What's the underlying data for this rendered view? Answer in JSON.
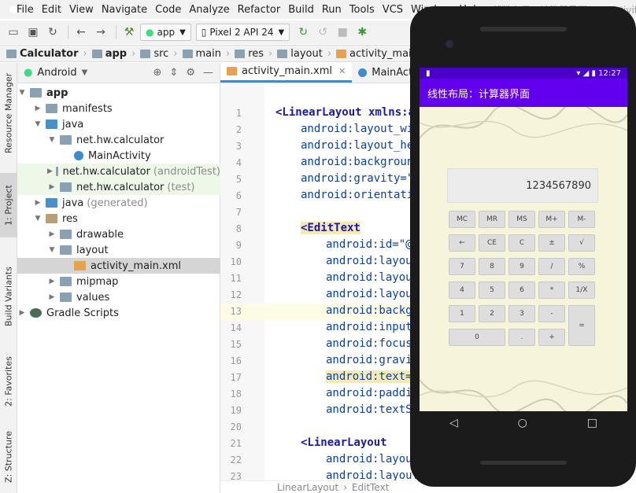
{
  "menubar": {
    "items": [
      "File",
      "Edit",
      "View",
      "Navigate",
      "Code",
      "Analyze",
      "Refactor",
      "Build",
      "Run",
      "Tools",
      "VCS",
      "Window",
      "Help"
    ],
    "title": "线性布局：计算器界面 - ...\\activity"
  },
  "toolbar": {
    "config": "app",
    "device": "Pixel 2 API 24"
  },
  "breadcrumbs": [
    "Calculator",
    "app",
    "src",
    "main",
    "res",
    "layout",
    "activity_main.xml"
  ],
  "leftstrip": {
    "tabs": [
      "Resource Manager",
      "1: Project",
      "Build Variants",
      "2: Favorites",
      "Z: Structure"
    ]
  },
  "project": {
    "view": "Android",
    "tree": [
      {
        "label": "app",
        "muted": ""
      },
      {
        "label": "manifests",
        "muted": ""
      },
      {
        "label": "java",
        "muted": ""
      },
      {
        "label": "net.hw.calculator",
        "muted": ""
      },
      {
        "label": "MainActivity",
        "muted": ""
      },
      {
        "label": "net.hw.calculator",
        "muted": "(androidTest)"
      },
      {
        "label": "net.hw.calculator",
        "muted": "(test)"
      },
      {
        "label": "java",
        "muted": "(generated)"
      },
      {
        "label": "res",
        "muted": ""
      },
      {
        "label": "drawable",
        "muted": ""
      },
      {
        "label": "layout",
        "muted": ""
      },
      {
        "label": "activity_main.xml",
        "muted": ""
      },
      {
        "label": "mipmap",
        "muted": ""
      },
      {
        "label": "values",
        "muted": ""
      },
      {
        "label": "Gradle Scripts",
        "muted": ""
      }
    ]
  },
  "editor": {
    "tabs": [
      "activity_main.xml",
      "MainActivity"
    ],
    "lines": [
      {
        "n": "1",
        "code": "<LinearLayout xmlns:an"
      },
      {
        "n": "2",
        "code": "android:layout_wid"
      },
      {
        "n": "3",
        "code": "android:layout_hei"
      },
      {
        "n": "4",
        "code": "android:background"
      },
      {
        "n": "5",
        "code": "android:gravity=\"c"
      },
      {
        "n": "6",
        "code": "android:orientatio"
      },
      {
        "n": "7",
        "code": ""
      },
      {
        "n": "8",
        "code": "<EditText"
      },
      {
        "n": "9",
        "code": "android:id=\"@+"
      },
      {
        "n": "10",
        "code": "android:layout"
      },
      {
        "n": "11",
        "code": "android:layout"
      },
      {
        "n": "12",
        "code": "android:layout"
      },
      {
        "n": "13",
        "code": "android:backgr"
      },
      {
        "n": "14",
        "code": "android:inputT"
      },
      {
        "n": "15",
        "code": "android:focusa"
      },
      {
        "n": "16",
        "code": "android:gravit"
      },
      {
        "n": "17",
        "code": "android:text=\""
      },
      {
        "n": "18",
        "code": "android:paddin"
      },
      {
        "n": "19",
        "code": "android:textSi"
      },
      {
        "n": "20",
        "code": ""
      },
      {
        "n": "21",
        "code": "<LinearLayout"
      },
      {
        "n": "22",
        "code": "android:layout"
      },
      {
        "n": "23",
        "code": "android:layout"
      }
    ],
    "status": [
      "LinearLayout",
      "EditText"
    ]
  },
  "phone": {
    "time": "12:27",
    "app_title": "线性布局：计算器界面",
    "display": "1234567890",
    "keys": [
      [
        "MC",
        "MR",
        "MS",
        "M+",
        "M-"
      ],
      [
        "←",
        "CE",
        "C",
        "±",
        "√"
      ],
      [
        "7",
        "8",
        "9",
        "/",
        "%"
      ],
      [
        "4",
        "5",
        "6",
        "*",
        "1/X"
      ],
      [
        "1",
        "2",
        "3",
        "-",
        "="
      ],
      [
        "0",
        ".",
        "+"
      ]
    ],
    "nav": [
      "◁",
      "○",
      "□"
    ]
  }
}
